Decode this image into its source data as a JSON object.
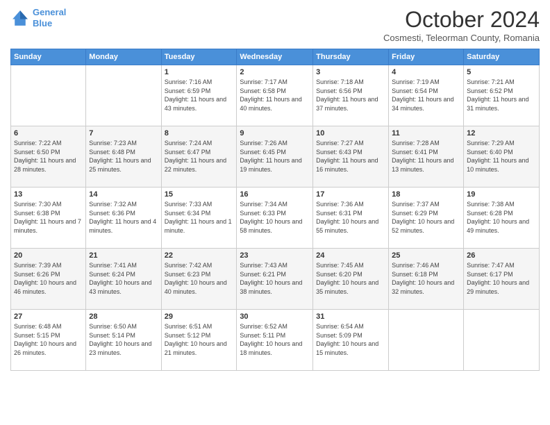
{
  "header": {
    "logo_line1": "General",
    "logo_line2": "Blue",
    "month_title": "October 2024",
    "subtitle": "Cosmesti, Teleorman County, Romania"
  },
  "days_of_week": [
    "Sunday",
    "Monday",
    "Tuesday",
    "Wednesday",
    "Thursday",
    "Friday",
    "Saturday"
  ],
  "weeks": [
    [
      {
        "day": "",
        "info": ""
      },
      {
        "day": "",
        "info": ""
      },
      {
        "day": "1",
        "info": "Sunrise: 7:16 AM\nSunset: 6:59 PM\nDaylight: 11 hours and 43 minutes."
      },
      {
        "day": "2",
        "info": "Sunrise: 7:17 AM\nSunset: 6:58 PM\nDaylight: 11 hours and 40 minutes."
      },
      {
        "day": "3",
        "info": "Sunrise: 7:18 AM\nSunset: 6:56 PM\nDaylight: 11 hours and 37 minutes."
      },
      {
        "day": "4",
        "info": "Sunrise: 7:19 AM\nSunset: 6:54 PM\nDaylight: 11 hours and 34 minutes."
      },
      {
        "day": "5",
        "info": "Sunrise: 7:21 AM\nSunset: 6:52 PM\nDaylight: 11 hours and 31 minutes."
      }
    ],
    [
      {
        "day": "6",
        "info": "Sunrise: 7:22 AM\nSunset: 6:50 PM\nDaylight: 11 hours and 28 minutes."
      },
      {
        "day": "7",
        "info": "Sunrise: 7:23 AM\nSunset: 6:48 PM\nDaylight: 11 hours and 25 minutes."
      },
      {
        "day": "8",
        "info": "Sunrise: 7:24 AM\nSunset: 6:47 PM\nDaylight: 11 hours and 22 minutes."
      },
      {
        "day": "9",
        "info": "Sunrise: 7:26 AM\nSunset: 6:45 PM\nDaylight: 11 hours and 19 minutes."
      },
      {
        "day": "10",
        "info": "Sunrise: 7:27 AM\nSunset: 6:43 PM\nDaylight: 11 hours and 16 minutes."
      },
      {
        "day": "11",
        "info": "Sunrise: 7:28 AM\nSunset: 6:41 PM\nDaylight: 11 hours and 13 minutes."
      },
      {
        "day": "12",
        "info": "Sunrise: 7:29 AM\nSunset: 6:40 PM\nDaylight: 11 hours and 10 minutes."
      }
    ],
    [
      {
        "day": "13",
        "info": "Sunrise: 7:30 AM\nSunset: 6:38 PM\nDaylight: 11 hours and 7 minutes."
      },
      {
        "day": "14",
        "info": "Sunrise: 7:32 AM\nSunset: 6:36 PM\nDaylight: 11 hours and 4 minutes."
      },
      {
        "day": "15",
        "info": "Sunrise: 7:33 AM\nSunset: 6:34 PM\nDaylight: 11 hours and 1 minute."
      },
      {
        "day": "16",
        "info": "Sunrise: 7:34 AM\nSunset: 6:33 PM\nDaylight: 10 hours and 58 minutes."
      },
      {
        "day": "17",
        "info": "Sunrise: 7:36 AM\nSunset: 6:31 PM\nDaylight: 10 hours and 55 minutes."
      },
      {
        "day": "18",
        "info": "Sunrise: 7:37 AM\nSunset: 6:29 PM\nDaylight: 10 hours and 52 minutes."
      },
      {
        "day": "19",
        "info": "Sunrise: 7:38 AM\nSunset: 6:28 PM\nDaylight: 10 hours and 49 minutes."
      }
    ],
    [
      {
        "day": "20",
        "info": "Sunrise: 7:39 AM\nSunset: 6:26 PM\nDaylight: 10 hours and 46 minutes."
      },
      {
        "day": "21",
        "info": "Sunrise: 7:41 AM\nSunset: 6:24 PM\nDaylight: 10 hours and 43 minutes."
      },
      {
        "day": "22",
        "info": "Sunrise: 7:42 AM\nSunset: 6:23 PM\nDaylight: 10 hours and 40 minutes."
      },
      {
        "day": "23",
        "info": "Sunrise: 7:43 AM\nSunset: 6:21 PM\nDaylight: 10 hours and 38 minutes."
      },
      {
        "day": "24",
        "info": "Sunrise: 7:45 AM\nSunset: 6:20 PM\nDaylight: 10 hours and 35 minutes."
      },
      {
        "day": "25",
        "info": "Sunrise: 7:46 AM\nSunset: 6:18 PM\nDaylight: 10 hours and 32 minutes."
      },
      {
        "day": "26",
        "info": "Sunrise: 7:47 AM\nSunset: 6:17 PM\nDaylight: 10 hours and 29 minutes."
      }
    ],
    [
      {
        "day": "27",
        "info": "Sunrise: 6:48 AM\nSunset: 5:15 PM\nDaylight: 10 hours and 26 minutes."
      },
      {
        "day": "28",
        "info": "Sunrise: 6:50 AM\nSunset: 5:14 PM\nDaylight: 10 hours and 23 minutes."
      },
      {
        "day": "29",
        "info": "Sunrise: 6:51 AM\nSunset: 5:12 PM\nDaylight: 10 hours and 21 minutes."
      },
      {
        "day": "30",
        "info": "Sunrise: 6:52 AM\nSunset: 5:11 PM\nDaylight: 10 hours and 18 minutes."
      },
      {
        "day": "31",
        "info": "Sunrise: 6:54 AM\nSunset: 5:09 PM\nDaylight: 10 hours and 15 minutes."
      },
      {
        "day": "",
        "info": ""
      },
      {
        "day": "",
        "info": ""
      }
    ]
  ]
}
